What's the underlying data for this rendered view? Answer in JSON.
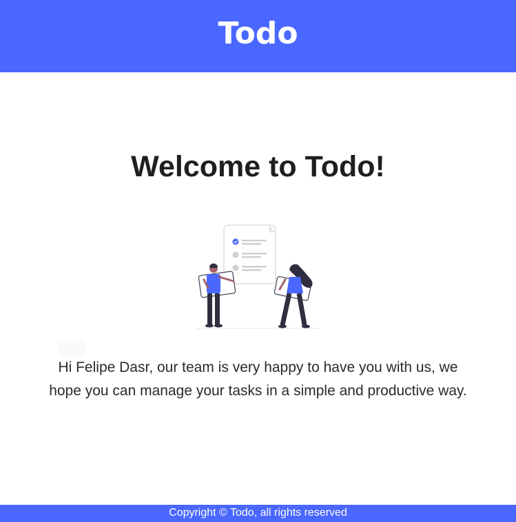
{
  "header": {
    "brand": "Todo",
    "background_color": "#4a67ff"
  },
  "main": {
    "title": "Welcome to Todo!",
    "illustration": "people-checklist-illustration",
    "message": "Hi Felipe Dasr, our team is very happy to have you with us, we hope you can manage your tasks in a simple and productive way."
  },
  "footer": {
    "copyright": "Copyright © Todo, all rights reserved",
    "background_color": "#4a67ff"
  }
}
